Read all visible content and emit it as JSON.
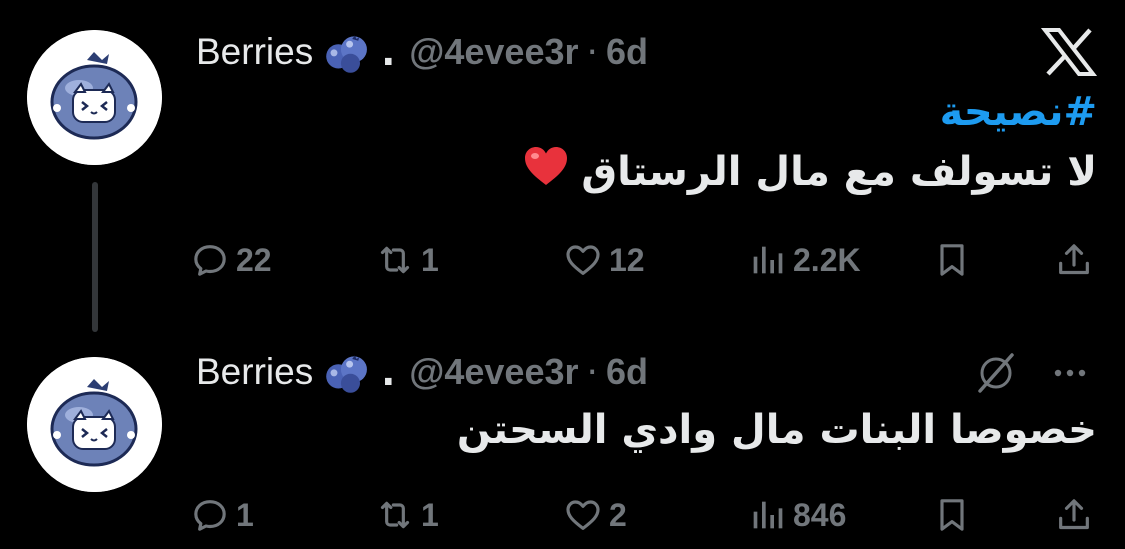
{
  "colors": {
    "background": "#000000",
    "text": "#e7e9ea",
    "muted": "#71767b",
    "link": "#1d9bf0",
    "thread_line": "#333639"
  },
  "app": {
    "logo_icon": "x-logo-icon"
  },
  "tweets": [
    {
      "author": {
        "name": "Berries",
        "emoji_icon": "blueberries-icon",
        "name_suffix": ".",
        "handle": "@4evee3r"
      },
      "separator": "·",
      "time": "6d",
      "hashtag": "#نصيحة",
      "text": "لا تسولف مع مال الرستاق",
      "emoji_icon": "red-heart-icon",
      "stats": {
        "replies": "22",
        "retweets": "1",
        "likes": "12",
        "views": "2.2K"
      }
    },
    {
      "author": {
        "name": "Berries",
        "emoji_icon": "blueberries-icon",
        "name_suffix": ".",
        "handle": "@4evee3r"
      },
      "separator": "·",
      "time": "6d",
      "text": "خصوصا البنات مال وادي السحتن",
      "menu_icons": [
        "grok-icon",
        "more-icon"
      ],
      "stats": {
        "replies": "1",
        "retweets": "1",
        "likes": "2",
        "views": "846"
      }
    }
  ]
}
